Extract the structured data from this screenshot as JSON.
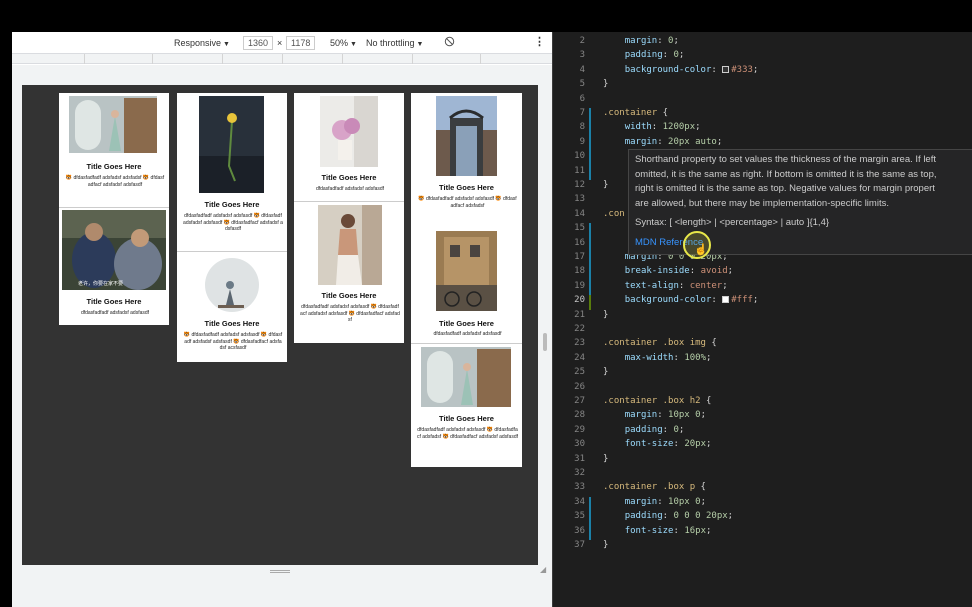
{
  "devtools": {
    "device": "Responsive",
    "width": "1360",
    "times": "×",
    "height": "1178",
    "zoom": "50%",
    "throttling": "No throttling"
  },
  "cards": [
    {
      "title": "Title Goes Here",
      "text": "🐯 dfdasfadfadf adsfadsf adsfadsf 🐯 dfdasfadfacf adsfadsf adsfasdf"
    },
    {
      "title": "Title Goes Here",
      "caption": "老许，你要在家不要",
      "text": "dfdasfadfadf adsfadsf adsfasdf"
    },
    {
      "title": "Title Goes Here",
      "text": "dfdasfadfadf adsfadsf adsfasdf 🐯 dfdasfadf adsfadsf adsfasdf 🐯 dfdasfadfacf adsfadsf adsfasdf"
    },
    {
      "title": "Title Goes Here",
      "text": "🐯 dfdasfadfadf adsfadsf adsfasdf 🐯 dfdasfadf adsfadsf adsfasdf 🐯 dfdasfadfacf adsfadsf acsfasdf"
    },
    {
      "title": "Title Goes Here",
      "text": "dfdasfadfadf adsfadsf adsfasdf"
    },
    {
      "title": "Title Goes Here",
      "text": "dfdasfadfadf adsfadsf adsfasdf 🐯 dfdasfadfacf adsfadsf adsfasdf 🐯 dfdasfadfacf adsfadsf"
    },
    {
      "title": "Title Goes Here",
      "text": "🐯 dfdasfadfadf adsfadsf adsfasdf 🐯 dfdasfadfacf adsfadsf"
    },
    {
      "title": "Title Goes Here",
      "text": "dfdasfadfadf adsfadsf adsfasdf"
    },
    {
      "title": "Title Goes Here",
      "text": "dfdasfadfadf adsfadsf adsfasdf 🐯 dfdasfadfacf adsfadsf 🐯 dfdasfadfacf adsfadsf adsfasdf"
    }
  ],
  "editor": {
    "lines": [
      {
        "n": "2",
        "code": "    margin: 0;"
      },
      {
        "n": "3",
        "code": "    padding: 0;"
      },
      {
        "n": "4",
        "code": "    background-color: #333;"
      },
      {
        "n": "5",
        "code": "}"
      },
      {
        "n": "6",
        "code": ""
      },
      {
        "n": "7",
        "code": ".container {"
      },
      {
        "n": "8",
        "code": "    width: 1200px;"
      },
      {
        "n": "9",
        "code": "    margin: 20px auto;"
      },
      {
        "n": "10",
        "code": ""
      },
      {
        "n": "11",
        "code": ""
      },
      {
        "n": "12",
        "code": "}"
      },
      {
        "n": "13",
        "code": ""
      },
      {
        "n": "14",
        "code": ".con"
      },
      {
        "n": "15",
        "code": ""
      },
      {
        "n": "16",
        "code": ""
      },
      {
        "n": "17",
        "code": "    margin: 0 0 0 20px;"
      },
      {
        "n": "18",
        "code": "    break-inside: avoid;"
      },
      {
        "n": "19",
        "code": "    text-align: center;"
      },
      {
        "n": "20",
        "code": "    background-color: #fff;"
      },
      {
        "n": "21",
        "code": "}"
      },
      {
        "n": "22",
        "code": ""
      },
      {
        "n": "23",
        "code": ".container .box img {"
      },
      {
        "n": "24",
        "code": "    max-width: 100%;"
      },
      {
        "n": "25",
        "code": "}"
      },
      {
        "n": "26",
        "code": ""
      },
      {
        "n": "27",
        "code": ".container .box h2 {"
      },
      {
        "n": "28",
        "code": "    margin: 10px 0;"
      },
      {
        "n": "29",
        "code": "    padding: 0;"
      },
      {
        "n": "30",
        "code": "    font-size: 20px;"
      },
      {
        "n": "31",
        "code": "}"
      },
      {
        "n": "32",
        "code": ""
      },
      {
        "n": "33",
        "code": ".container .box p {"
      },
      {
        "n": "34",
        "code": "    margin: 10px 0;"
      },
      {
        "n": "35",
        "code": "    padding: 0 0 0 20px;"
      },
      {
        "n": "36",
        "code": "    font-size: 16px;"
      },
      {
        "n": "37",
        "code": "}"
      }
    ],
    "current_line": "20"
  },
  "hover": {
    "line1": "Shorthand property to set values the thickness of the margin area. If left",
    "line2": "omitted, it is the same as right. If bottom is omitted it is the same as top,",
    "line3": "right is omitted it is the same as top. Negative values for margin propert",
    "line4": "are allowed, but there may be implementation-specific limits.",
    "syntax": "Syntax: [ <length> | <percentage> | auto ]{1,4}",
    "link": "MDN Reference"
  }
}
